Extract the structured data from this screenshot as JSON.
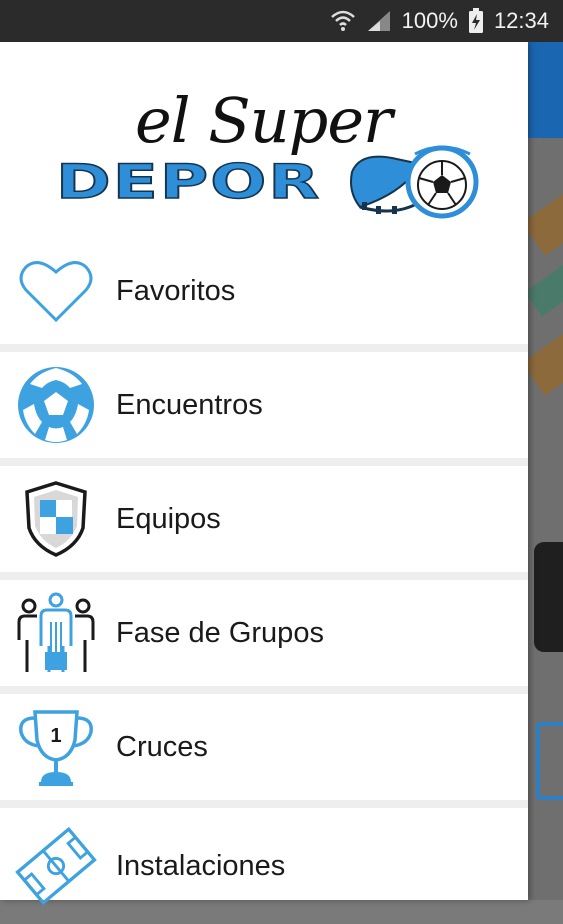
{
  "status_bar": {
    "battery_percent": "100%",
    "time": "12:34"
  },
  "drawer": {
    "logo": {
      "script_text": "el Super",
      "main_text": "DEPOR"
    },
    "menu_items": [
      {
        "label": "Favoritos",
        "icon": "heart-icon"
      },
      {
        "label": "Encuentros",
        "icon": "soccer-ball-icon"
      },
      {
        "label": "Equipos",
        "icon": "shield-icon"
      },
      {
        "label": "Fase de Grupos",
        "icon": "group-people-icon"
      },
      {
        "label": "Cruces",
        "icon": "trophy-icon"
      },
      {
        "label": "Instalaciones",
        "icon": "soccer-field-icon"
      }
    ]
  },
  "colors": {
    "accent": "#3fa2e0",
    "status_bar": "#2b2b2b",
    "toolbar": "#1b66b0"
  }
}
